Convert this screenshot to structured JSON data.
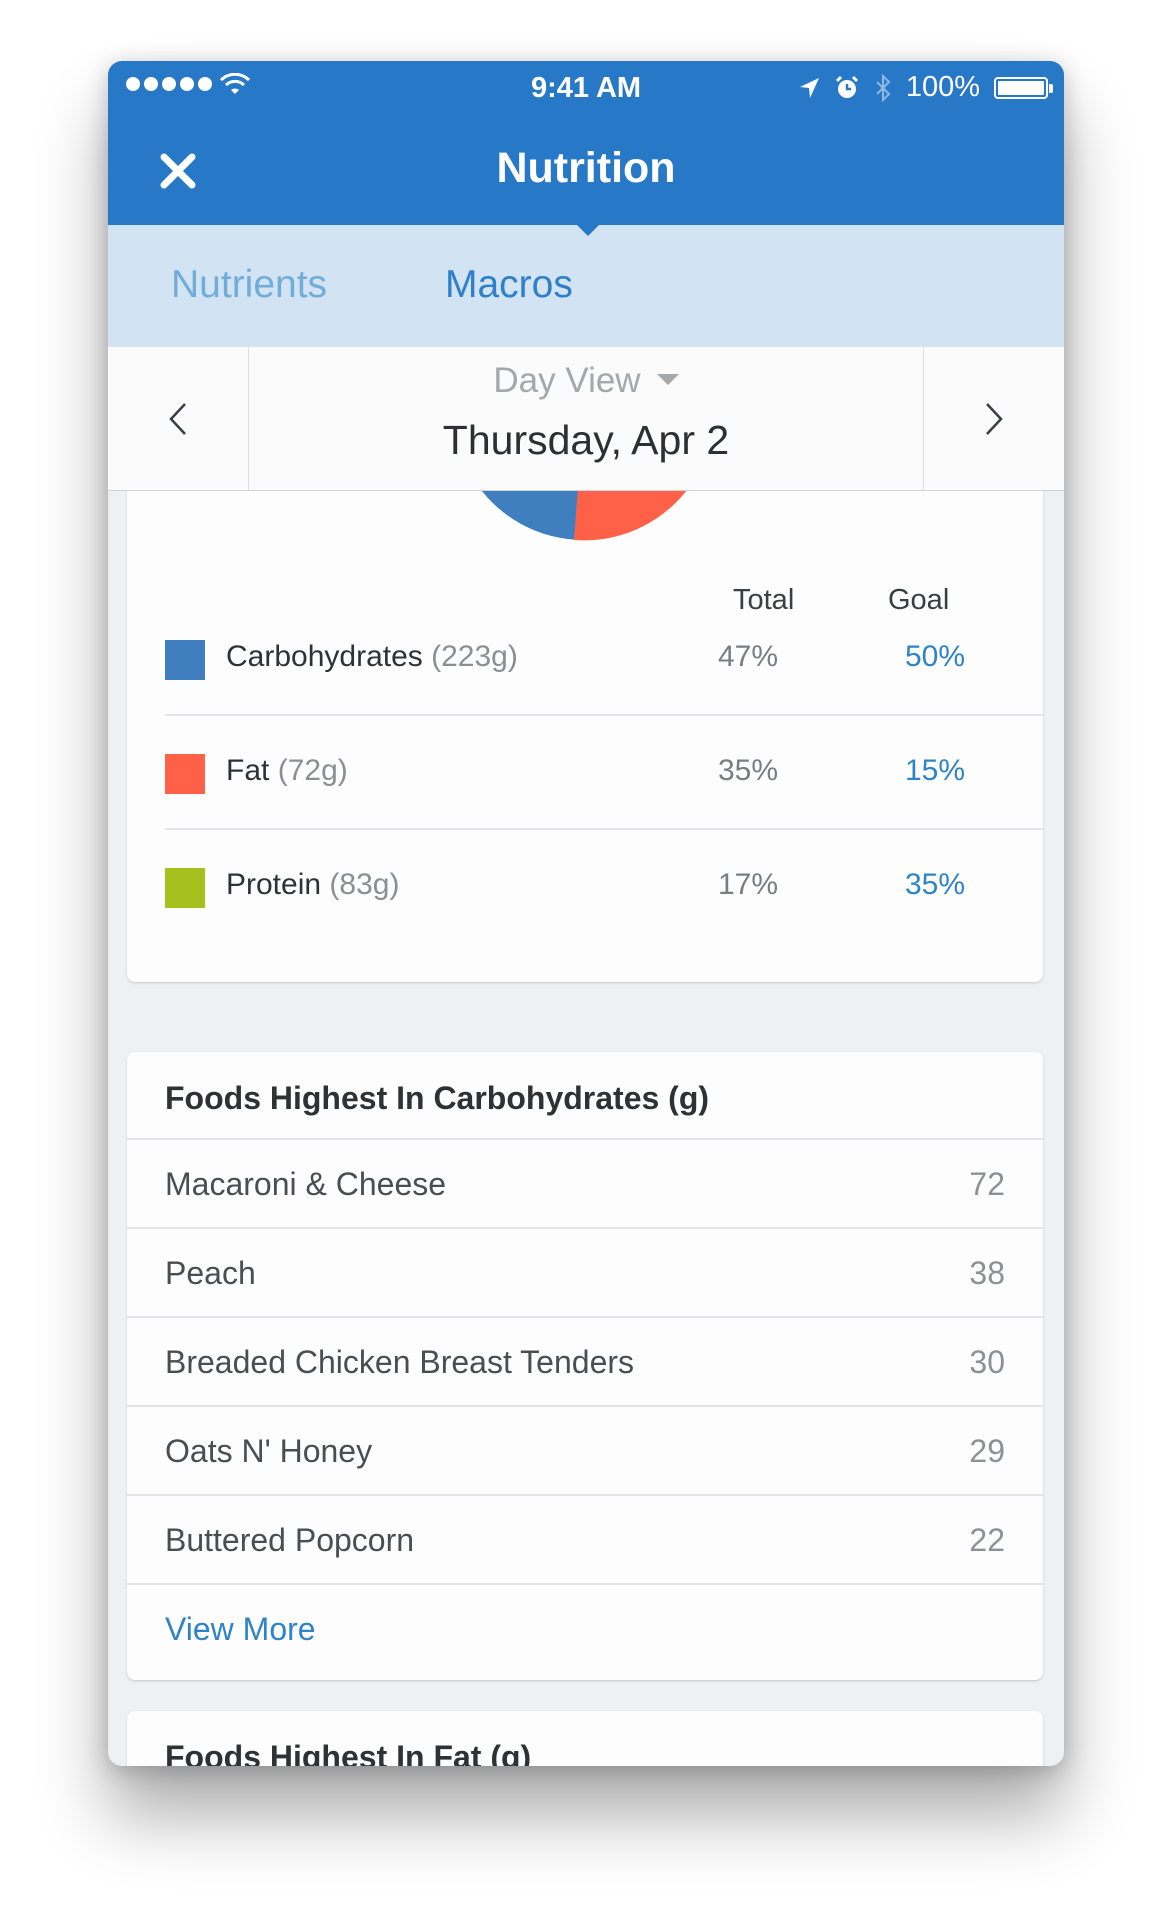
{
  "status_bar": {
    "time": "9:41 AM",
    "battery": "100%",
    "icons": [
      "signal-dots-icon",
      "wifi-icon",
      "location-arrow-icon",
      "alarm-icon",
      "bluetooth-icon",
      "battery-icon"
    ]
  },
  "nav": {
    "title": "Nutrition",
    "close_icon": "close-icon"
  },
  "tabs": [
    {
      "label": "Nutrients",
      "active": false
    },
    {
      "label": "Macros",
      "active": true
    }
  ],
  "date_selector": {
    "view_label": "Day View",
    "date": "Thursday, Apr 2"
  },
  "macros": {
    "headers": {
      "total": "Total",
      "goal": "Goal"
    },
    "rows": [
      {
        "name": "Carbohydrates",
        "grams": "(223g)",
        "total": "47%",
        "goal": "50%",
        "color": "#3f7fbf"
      },
      {
        "name": "Fat",
        "grams": "(72g)",
        "total": "35%",
        "goal": "15%",
        "color": "#ff6148"
      },
      {
        "name": "Protein",
        "grams": "(83g)",
        "total": "17%",
        "goal": "35%",
        "color": "#a6c11d"
      }
    ]
  },
  "foods_carbs": {
    "title": "Foods Highest In Carbohydrates (g)",
    "items": [
      {
        "name": "Macaroni & Cheese",
        "value": "72"
      },
      {
        "name": "Peach",
        "value": "38"
      },
      {
        "name": "Breaded Chicken Breast Tenders",
        "value": "30"
      },
      {
        "name": "Oats N' Honey",
        "value": "29"
      },
      {
        "name": "Buttered Popcorn",
        "value": "22"
      }
    ],
    "view_more": "View More"
  },
  "foods_fat": {
    "title": "Foods Highest In Fat (g)"
  },
  "colors": {
    "primary": "#2878c8",
    "tab_bar": "#d2e3f4",
    "link": "#2f84c9"
  }
}
